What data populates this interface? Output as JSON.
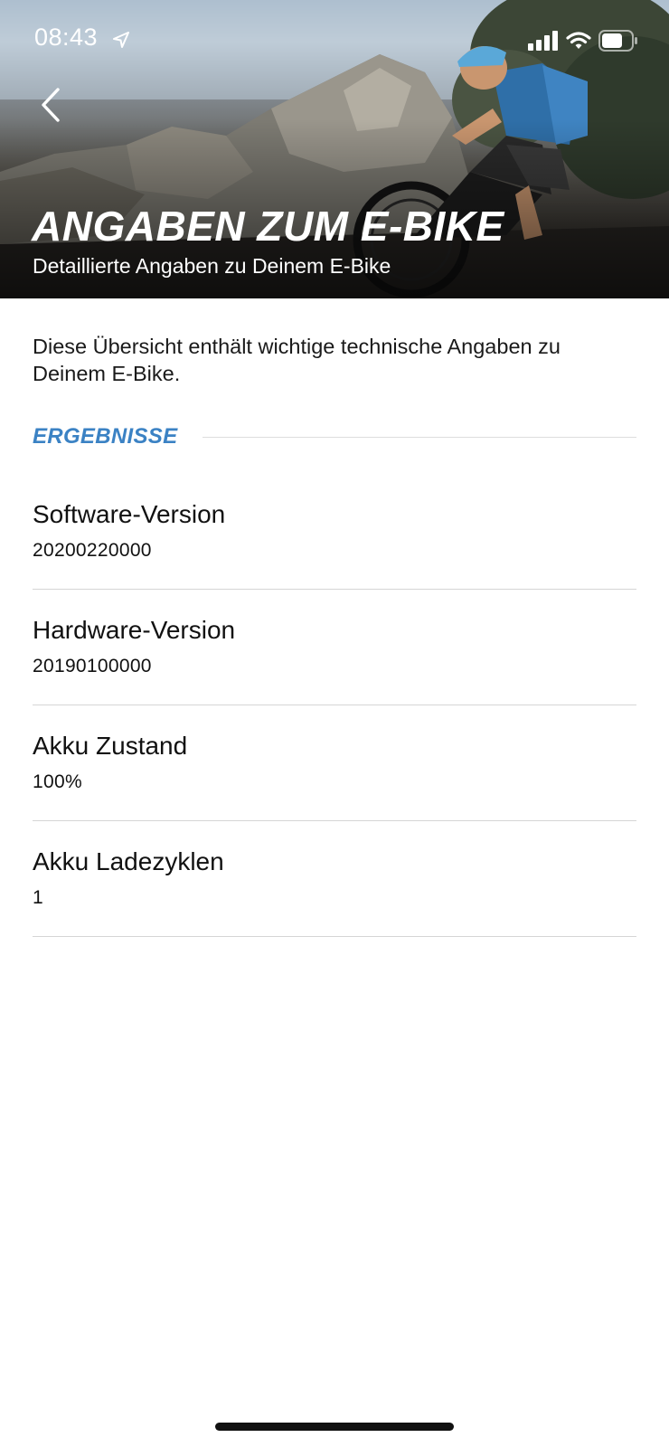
{
  "status_bar": {
    "time": "08:43"
  },
  "header": {
    "title": "ANGABEN ZUM E-BIKE",
    "subtitle": "Detaillierte Angaben zu Deinem E-Bike"
  },
  "intro_text": "Diese Übersicht enthält wichtige technische Angaben zu Deinem E-Bike.",
  "section": {
    "title": "ERGEBNISSE"
  },
  "results": [
    {
      "label": "Software-Version",
      "value": "20200220000"
    },
    {
      "label": "Hardware-Version",
      "value": "20190100000"
    },
    {
      "label": "Akku Zustand",
      "value": "100%"
    },
    {
      "label": "Akku Ladezyklen",
      "value": "1"
    }
  ],
  "colors": {
    "accent": "#3b82c4",
    "text": "#111111",
    "divider": "#d5d5d5"
  },
  "icons": {
    "back": "chevron-left-icon",
    "location": "location-arrow-icon",
    "signal": "cellular-signal-icon",
    "wifi": "wifi-icon",
    "battery": "battery-icon"
  }
}
